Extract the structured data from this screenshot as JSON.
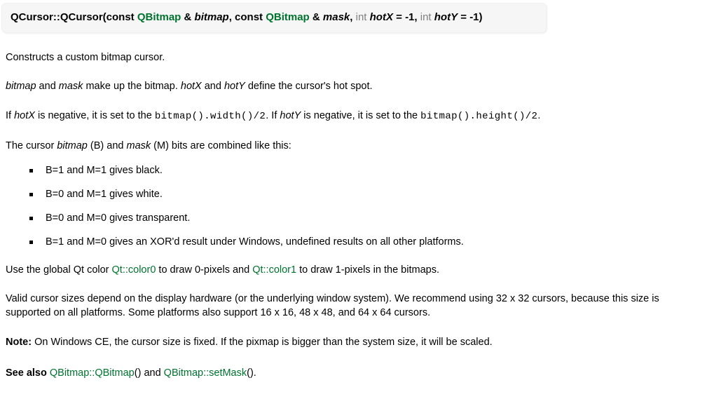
{
  "signature": {
    "tokens": [
      {
        "text": "QCursor::QCursor(const ",
        "kind": "plain"
      },
      {
        "text": "QBitmap",
        "kind": "type-link"
      },
      {
        "text": " & ",
        "kind": "plain"
      },
      {
        "text": "bitmap",
        "kind": "param"
      },
      {
        "text": ", const ",
        "kind": "plain"
      },
      {
        "text": "QBitmap",
        "kind": "type-link"
      },
      {
        "text": " & ",
        "kind": "plain"
      },
      {
        "text": "mask",
        "kind": "param"
      },
      {
        "text": ", ",
        "kind": "plain"
      },
      {
        "text": "int ",
        "kind": "keyword"
      },
      {
        "text": "hotX",
        "kind": "param"
      },
      {
        "text": " = -1, ",
        "kind": "plain"
      },
      {
        "text": "int ",
        "kind": "keyword"
      },
      {
        "text": "hotY",
        "kind": "param"
      },
      {
        "text": " = -1)",
        "kind": "plain"
      }
    ],
    "line1_prefix": "QCursor::QCursor(const ",
    "type1": "QBitmap",
    "amp1": " & ",
    "param1": "bitmap",
    "mid1": ", const ",
    "type2": "QBitmap",
    "amp2": " & ",
    "param2": "mask",
    "comma2": ", ",
    "kw1": "int ",
    "param3": "hotX",
    "default1": " = -1, ",
    "kw2": "int",
    "param4": "hotY",
    "default2": " = -1)"
  },
  "paragraphs": {
    "intro": "Constructs a custom bitmap cursor.",
    "p2": {
      "a": "bitmap",
      "b": " and ",
      "c": "mask",
      "d": " make up the bitmap. ",
      "e": "hotX",
      "f": " and ",
      "g": "hotY",
      "h": " define the cursor's hot spot."
    },
    "p3": {
      "a": "If ",
      "b": "hotX",
      "c": " is negative, it is set to the ",
      "d": "bitmap().width()/2",
      "e": ". If ",
      "f": "hotY",
      "g": " is negative, it is set to the ",
      "h": "bitmap().height()/2",
      "i": "."
    },
    "p4": {
      "a": "The cursor ",
      "b": "bitmap",
      "c": " (B) and ",
      "d": "mask",
      "e": " (M) bits are combined like this:"
    },
    "p5": {
      "a": "Use the global Qt color ",
      "b": "Qt::color0",
      "c": " to draw 0-pixels and ",
      "d": "Qt::color1",
      "e": " to draw 1-pixels in the bitmaps."
    },
    "p6": "Valid cursor sizes depend on the display hardware (or the underlying window system). We recommend using 32 x 32 cursors, because this size is supported on all platforms. Some platforms also support 16 x 16, 48 x 48, and 64 x 64 cursors.",
    "note": {
      "label": "Note:",
      "text": " On Windows CE, the cursor size is fixed. If the pixmap is bigger than the system size, it will be scaled."
    },
    "see_also": {
      "label": "See also",
      "space1": " ",
      "link1": "QBitmap::QBitmap",
      "paren1": "()",
      "between": " and ",
      "link2": "QBitmap::setMask",
      "paren2": "()."
    }
  },
  "bullets": [
    "B=1 and M=1 gives black.",
    "B=0 and M=1 gives white.",
    "B=0 and M=0 gives transparent.",
    "B=1 and M=0 gives an XOR'd result under Windows, undefined results on all other platforms."
  ],
  "colors": {
    "link_green": "#00732f",
    "keyword_gray": "#808080",
    "signature_background": "#f6f6f6",
    "page_background": "#ffffff",
    "text": "#000000"
  }
}
